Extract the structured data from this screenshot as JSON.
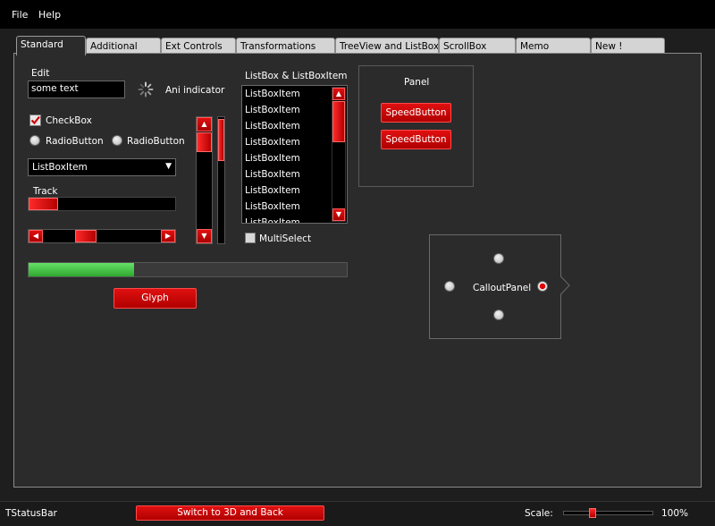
{
  "menubar": {
    "items": [
      "File",
      "Help"
    ]
  },
  "tabs": [
    {
      "label": "Standard",
      "active": true
    },
    {
      "label": "Additional"
    },
    {
      "label": "Ext Controls"
    },
    {
      "label": "Transformations"
    },
    {
      "label": "TreeView and ListBox"
    },
    {
      "label": "ScrollBox"
    },
    {
      "label": "Memo"
    },
    {
      "label": "New !"
    }
  ],
  "standard": {
    "edit_label": "Edit",
    "edit_value": "some text",
    "ani_label": "Ani indicator",
    "checkbox_label": "CheckBox",
    "checkbox_checked": true,
    "radio1_label": "RadioButton",
    "radio2_label": "RadioButton",
    "combo_value": "ListBoxItem",
    "track_label": "Track",
    "track_value_percent": 0,
    "scrollbar_value_percent": 25,
    "progress_percent": 33,
    "glyph_label": "Glyph",
    "vscroll1_percent": 5,
    "vscroll2_percent": 3
  },
  "listbox": {
    "title": "ListBox & ListBoxItem",
    "items": [
      "ListBoxItem",
      "ListBoxItem",
      "ListBoxItem",
      "ListBoxItem",
      "ListBoxItem",
      "ListBoxItem",
      "ListBoxItem",
      "ListBoxItem",
      "ListBoxItem"
    ],
    "multiselect_label": "MultiSelect",
    "multiselect_checked": false
  },
  "panel": {
    "title": "Panel",
    "button1": "SpeedButton",
    "button2": "SpeedButton"
  },
  "callout": {
    "label": "CalloutPanel",
    "selected": "right"
  },
  "statusbar": {
    "label": "TStatusBar",
    "button": "Switch to 3D and Back",
    "scale_label": "Scale:",
    "scale_value": "100%",
    "scale_percent": 33
  },
  "colors": {
    "accent_red": "#d00000",
    "progress_green": "#3cc43c",
    "background": "#2b2b2b"
  }
}
